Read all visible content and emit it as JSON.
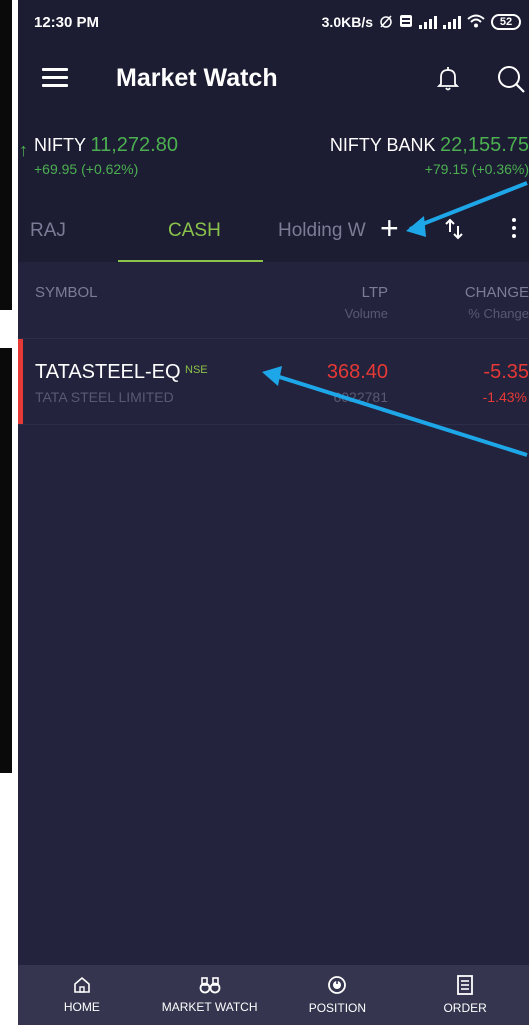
{
  "status_bar": {
    "time": "12:30 PM",
    "network_speed": "3.0KB/s",
    "battery": "52"
  },
  "app_bar": {
    "title": "Market Watch"
  },
  "ticker": {
    "nifty": {
      "name": "NIFTY",
      "price": "11,272.80",
      "change": "+69.95  (+0.62%)"
    },
    "nifty_bank": {
      "name": "NIFTY BANK",
      "price": "22,155.75",
      "change": "+79.15  (+0.36%)"
    }
  },
  "tabs": [
    {
      "label": "RAJ"
    },
    {
      "label": "CASH"
    },
    {
      "label": "Holding W"
    }
  ],
  "active_tab": "CASH",
  "columns": {
    "symbol": "SYMBOL",
    "ltp": "LTP",
    "volume": "Volume",
    "change": "CHANGE",
    "pct_change": "% Change"
  },
  "rows": [
    {
      "symbol": "TATASTEEL-EQ",
      "exchange": "NSE",
      "company": "TATA STEEL LIMITED",
      "ltp": "368.40",
      "volume": "6022781",
      "change": "-5.35",
      "pct_change": "-1.43%"
    }
  ],
  "bottom_nav": [
    {
      "label": "HOME",
      "icon": "home-icon"
    },
    {
      "label": "MARKET WATCH",
      "icon": "binoculars-icon"
    },
    {
      "label": "POSITION",
      "icon": "position-icon"
    },
    {
      "label": "ORDER",
      "icon": "order-icon"
    }
  ],
  "colors": {
    "background": "#23233d",
    "header": "#1c1c33",
    "positive": "#4caf50",
    "negative": "#e53935",
    "accent": "#8bc34a",
    "annotation_arrow": "#1ea7e8"
  }
}
